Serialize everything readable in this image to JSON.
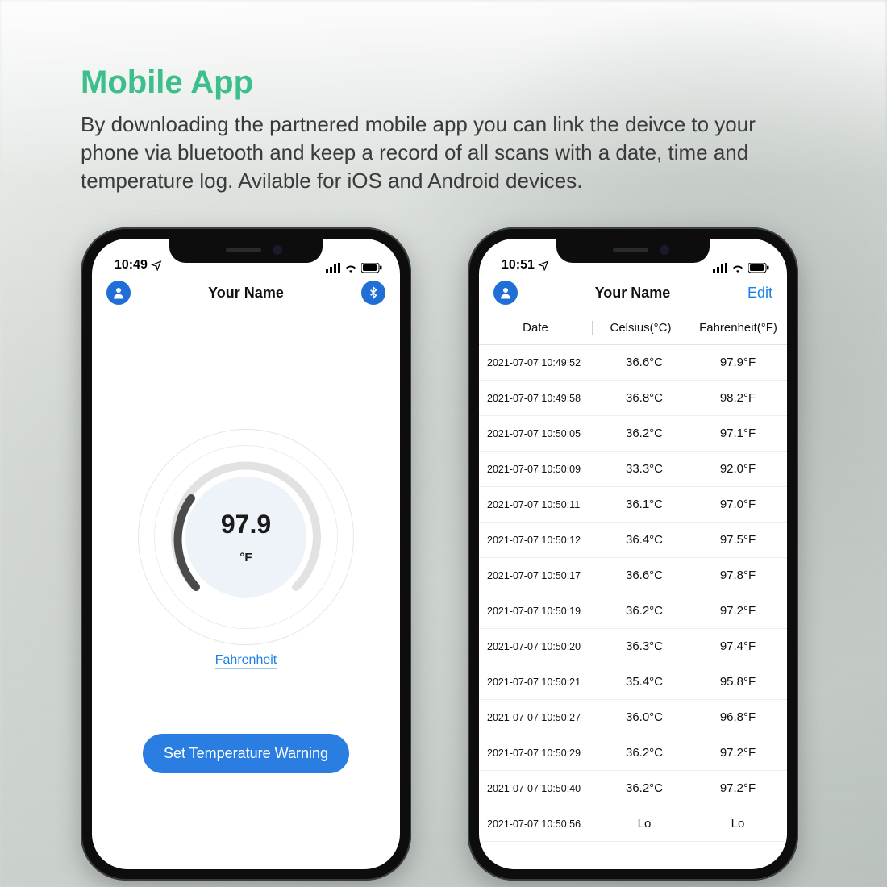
{
  "hero": {
    "title": "Mobile App",
    "body": "By downloading the partnered mobile app you can link the deivce to your phone via bluetooth and keep a record of all scans with a date, time and temperature log. Avilable for iOS and Android devices."
  },
  "phone1": {
    "status_time": "10:49",
    "nav_title": "Your Name",
    "temp_value": "97.9",
    "temp_unit": "°F",
    "unit_link": "Fahrenheit",
    "warning_btn": "Set Temperature Warning"
  },
  "phone2": {
    "status_time": "10:51",
    "nav_title": "Your Name",
    "edit": "Edit",
    "headers": {
      "date": "Date",
      "celsius": "Celsius(°C)",
      "fahrenheit": "Fahrenheit(°F)"
    },
    "rows": [
      {
        "d": "2021-07-07 10:49:52",
        "c": "36.6°C",
        "f": "97.9°F"
      },
      {
        "d": "2021-07-07 10:49:58",
        "c": "36.8°C",
        "f": "98.2°F"
      },
      {
        "d": "2021-07-07 10:50:05",
        "c": "36.2°C",
        "f": "97.1°F"
      },
      {
        "d": "2021-07-07 10:50:09",
        "c": "33.3°C",
        "f": "92.0°F"
      },
      {
        "d": "2021-07-07 10:50:11",
        "c": "36.1°C",
        "f": "97.0°F"
      },
      {
        "d": "2021-07-07 10:50:12",
        "c": "36.4°C",
        "f": "97.5°F"
      },
      {
        "d": "2021-07-07 10:50:17",
        "c": "36.6°C",
        "f": "97.8°F"
      },
      {
        "d": "2021-07-07 10:50:19",
        "c": "36.2°C",
        "f": "97.2°F"
      },
      {
        "d": "2021-07-07 10:50:20",
        "c": "36.3°C",
        "f": "97.4°F"
      },
      {
        "d": "2021-07-07 10:50:21",
        "c": "35.4°C",
        "f": "95.8°F"
      },
      {
        "d": "2021-07-07 10:50:27",
        "c": "36.0°C",
        "f": "96.8°F"
      },
      {
        "d": "2021-07-07 10:50:29",
        "c": "36.2°C",
        "f": "97.2°F"
      },
      {
        "d": "2021-07-07 10:50:40",
        "c": "36.2°C",
        "f": "97.2°F"
      },
      {
        "d": "2021-07-07 10:50:56",
        "c": "Lo",
        "f": "Lo"
      }
    ]
  }
}
